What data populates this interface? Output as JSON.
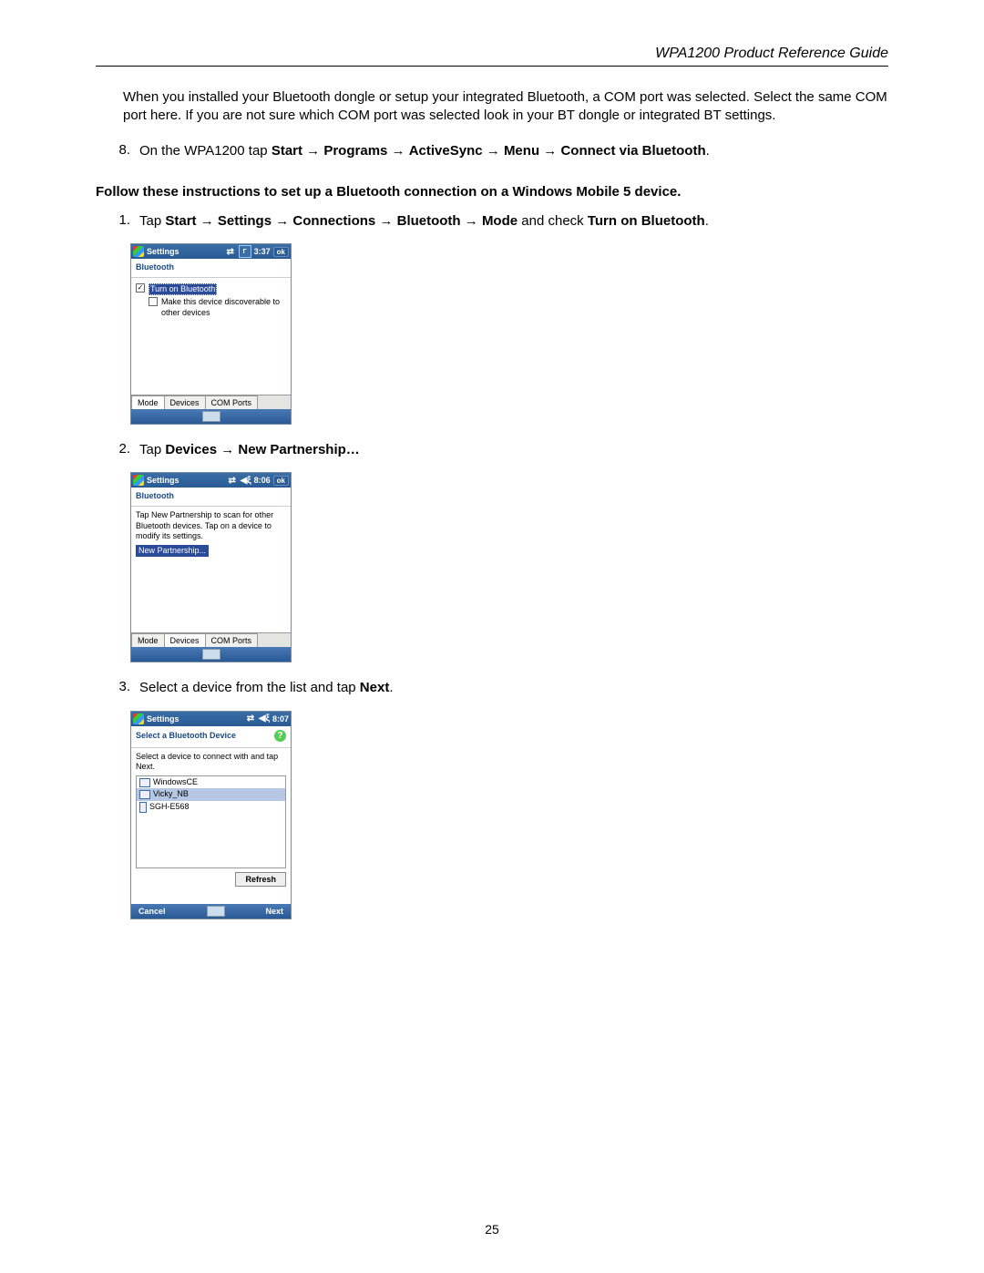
{
  "header": {
    "title": "WPA1200 Product Reference Guide"
  },
  "intro_para": "When you installed your Bluetooth dongle or setup your integrated Bluetooth, a COM port was selected. Select the same COM port here. If you are not sure which COM port was selected look in your BT dongle or integrated BT settings.",
  "step8": {
    "num": "8.",
    "pre": "On the WPA1200 tap ",
    "path": [
      "Start",
      "Programs",
      "ActiveSync",
      "Menu",
      "Connect via Bluetooth"
    ],
    "post": "."
  },
  "section_title": "Follow these instructions to set up a Bluetooth connection on a Windows Mobile 5 device.",
  "steps": [
    {
      "num": "1.",
      "pre": "Tap ",
      "path": [
        "Start",
        "Settings",
        "Connections",
        "Bluetooth",
        "Mode"
      ],
      "mid": " and check ",
      "tail_bold": "Turn on Bluetooth",
      "post": "."
    },
    {
      "num": "2.",
      "pre": "Tap ",
      "path": [
        "Devices",
        "New Partnership…"
      ]
    },
    {
      "num": "3.",
      "pre": "Select a device from the list and tap ",
      "tail_bold": "Next",
      "post": "."
    }
  ],
  "wm_common": {
    "title": "Settings",
    "ok": "ok",
    "tabs": [
      "Mode",
      "Devices",
      "COM Ports"
    ]
  },
  "wm1": {
    "time": "3:37",
    "sub": "Bluetooth",
    "chk1": "Turn on Bluetooth",
    "chk2": "Make this device discoverable to other devices",
    "active_tab": 0
  },
  "wm2": {
    "time": "8:06",
    "sub": "Bluetooth",
    "desc": "Tap New Partnership to scan for other Bluetooth devices. Tap on a device to modify its settings.",
    "item": "New Partnership...",
    "active_tab": 1
  },
  "wm3": {
    "time": "8:07",
    "sub": "Select a Bluetooth Device",
    "desc": "Select a device to connect with and tap Next.",
    "devices": [
      "WindowsCE",
      "Vicky_NB",
      "SGH-E568"
    ],
    "selected": 1,
    "refresh": "Refresh",
    "cancel": "Cancel",
    "next": "Next"
  },
  "arrow": "→",
  "page_number": "25"
}
